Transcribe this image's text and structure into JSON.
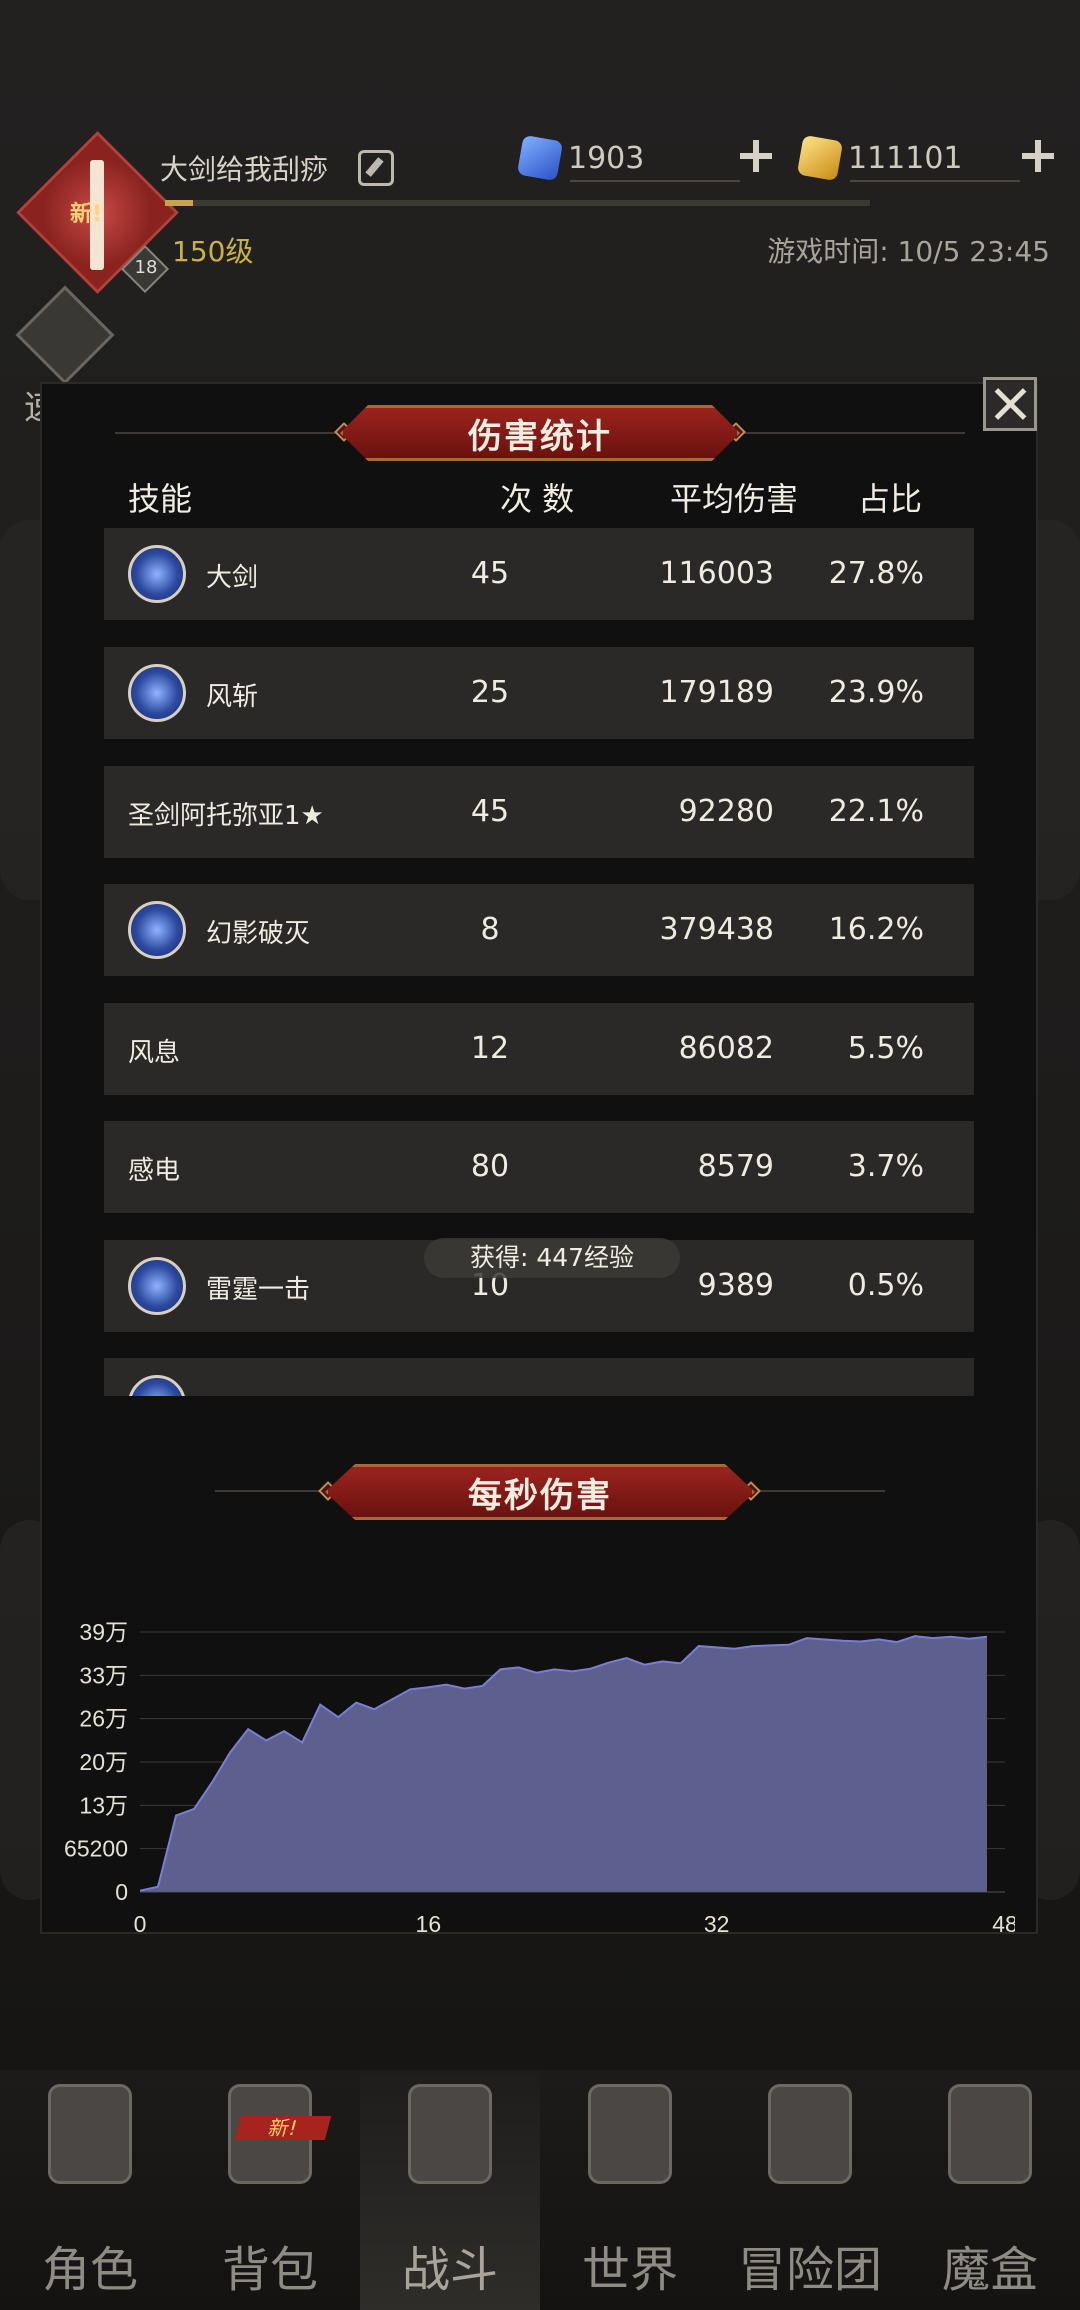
{
  "header": {
    "player_name": "大剑给我刮痧",
    "level": "150级",
    "avatar_level": "18",
    "avatar_new_tag": "新!",
    "game_time": "游戏时间: 10/5 23:45",
    "currency_gem": "1903",
    "currency_gold": "111101",
    "xp_progress": 0.04
  },
  "side": {
    "speed_label": "速战"
  },
  "damage_stats": {
    "title": "伤害统计",
    "columns": {
      "skill": "技能",
      "count": "次 数",
      "avg": "平均伤害",
      "pct": "占比"
    },
    "rows": [
      {
        "name": "大剑",
        "icon": "sword-skill-icon",
        "count": "45",
        "avg": "116003",
        "pct": "27.8%"
      },
      {
        "name": "风斩",
        "icon": "wind-slash-icon",
        "count": "25",
        "avg": "179189",
        "pct": "23.9%"
      },
      {
        "name": "圣剑阿托弥亚1★",
        "icon": "",
        "count": "45",
        "avg": "92280",
        "pct": "22.1%"
      },
      {
        "name": "幻影破灭",
        "icon": "phantom-icon",
        "count": "8",
        "avg": "379438",
        "pct": "16.2%"
      },
      {
        "name": "风息",
        "icon": "",
        "count": "12",
        "avg": "86082",
        "pct": "5.5%"
      },
      {
        "name": "感电",
        "icon": "",
        "count": "80",
        "avg": "8579",
        "pct": "3.7%"
      },
      {
        "name": "雷霆一击",
        "icon": "thunder-icon",
        "count": "10",
        "avg": "9389",
        "pct": "0.5%"
      },
      {
        "name": "",
        "icon": "skill-icon",
        "count": "",
        "avg": "",
        "pct": ""
      }
    ],
    "toast": "获得: 447经验"
  },
  "dps": {
    "title": "每秒伤害"
  },
  "chart_data": {
    "type": "area",
    "title": "每秒伤害",
    "xlabel": "",
    "ylabel": "",
    "x_ticks": [
      "0",
      "16",
      "32",
      "48"
    ],
    "y_ticks": [
      "0",
      "65200",
      "13万",
      "20万",
      "26万",
      "33万",
      "39万"
    ],
    "xlim": [
      0,
      48
    ],
    "ylim": [
      0,
      391200
    ],
    "grid": true,
    "color": "#5d5f8e",
    "x": [
      0,
      1,
      2,
      3,
      4,
      5,
      6,
      7,
      8,
      9,
      10,
      11,
      12,
      13,
      14,
      15,
      16,
      17,
      18,
      19,
      20,
      21,
      22,
      23,
      24,
      25,
      26,
      27,
      28,
      29,
      30,
      31,
      32,
      33,
      34,
      35,
      36,
      37,
      38,
      39,
      40,
      41,
      42,
      43,
      44,
      45,
      46,
      47
    ],
    "y": [
      2000,
      8000,
      115000,
      125000,
      165000,
      210000,
      245000,
      228000,
      242000,
      225000,
      282000,
      263000,
      285000,
      275000,
      290000,
      305000,
      308000,
      312000,
      306000,
      310000,
      335000,
      338000,
      330000,
      335000,
      332000,
      336000,
      345000,
      352000,
      342000,
      347000,
      344000,
      370000,
      368000,
      366000,
      370000,
      371000,
      372000,
      382000,
      380000,
      378000,
      377000,
      380000,
      376000,
      385000,
      382000,
      384000,
      381000,
      384000
    ]
  },
  "nav": {
    "items": [
      {
        "label": "角色"
      },
      {
        "label": "背包",
        "badge": "新!"
      },
      {
        "label": "战斗"
      },
      {
        "label": "世界"
      },
      {
        "label": "冒险团"
      },
      {
        "label": "魔盒"
      }
    ]
  }
}
